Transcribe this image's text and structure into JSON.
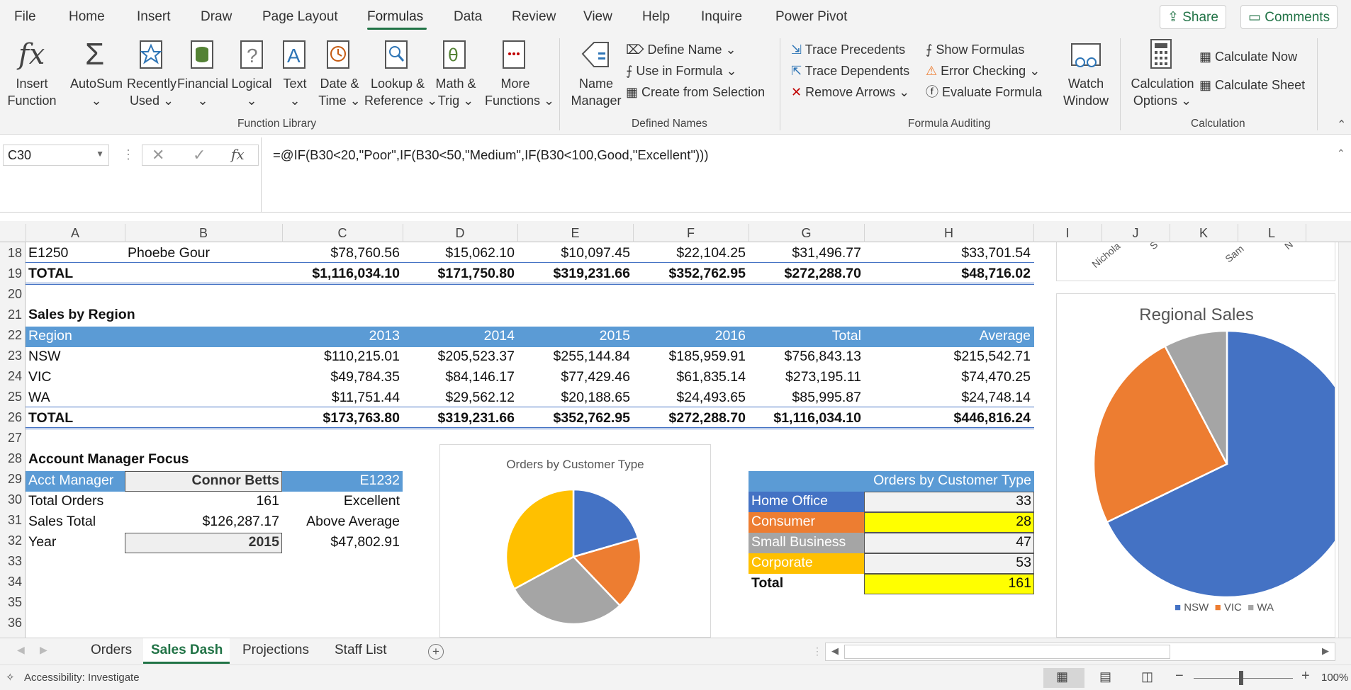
{
  "menu": {
    "items": [
      "File",
      "Home",
      "Insert",
      "Draw",
      "Page Layout",
      "Formulas",
      "Data",
      "Review",
      "View",
      "Help",
      "Inquire",
      "Power Pivot"
    ],
    "active": "Formulas",
    "share": "Share",
    "comments": "Comments"
  },
  "ribbon": {
    "insert_function": [
      "Insert",
      "Function"
    ],
    "autosum": "AutoSum",
    "recently_used": [
      "Recently",
      "Used"
    ],
    "financial": "Financial",
    "logical": "Logical",
    "text": "Text",
    "date_time": [
      "Date &",
      "Time"
    ],
    "lookup": [
      "Lookup &",
      "Reference"
    ],
    "math": [
      "Math &",
      "Trig"
    ],
    "more": [
      "More",
      "Functions"
    ],
    "group_function_library": "Function Library",
    "name_manager": [
      "Name",
      "Manager"
    ],
    "define_name": "Define Name",
    "use_in_formula": "Use in Formula",
    "create_from_selection": "Create from Selection",
    "group_defined_names": "Defined Names",
    "trace_precedents": "Trace Precedents",
    "trace_dependents": "Trace Dependents",
    "remove_arrows": "Remove Arrows",
    "show_formulas": "Show Formulas",
    "error_checking": "Error Checking",
    "evaluate_formula": "Evaluate Formula",
    "group_formula_auditing": "Formula Auditing",
    "watch_window": [
      "Watch",
      "Window"
    ],
    "calc_options": [
      "Calculation",
      "Options"
    ],
    "calc_now": "Calculate Now",
    "calc_sheet": "Calculate Sheet",
    "group_calculation": "Calculation"
  },
  "formula_bar": {
    "name_box": "C30",
    "fx": "fx",
    "formula": "=@IF(B30<20,\"Poor\",IF(B30<50,\"Medium\",IF(B30<100,Good,\"Excellent\")))"
  },
  "columns": [
    "A",
    "B",
    "C",
    "D",
    "E",
    "F",
    "G",
    "H",
    "I",
    "J",
    "K",
    "L"
  ],
  "rows": [
    "18",
    "19",
    "20",
    "21",
    "22",
    "23",
    "24",
    "25",
    "26",
    "27",
    "28",
    "29",
    "30",
    "31",
    "32",
    "33",
    "34",
    "35",
    "36"
  ],
  "sheet": {
    "r18": [
      "E1250",
      "Phoebe Gour",
      "$78,760.56",
      "$15,062.10",
      "$10,097.45",
      "$22,104.25",
      "$31,496.77",
      "$33,701.54"
    ],
    "r19": [
      "TOTAL",
      "$1,116,034.10",
      "$171,750.80",
      "$319,231.66",
      "$352,762.95",
      "$272,288.70",
      "$48,716.02"
    ],
    "sales_title": "Sales by Region",
    "sales_header": [
      "Region",
      "2013",
      "2014",
      "2015",
      "2016",
      "Total",
      "Average"
    ],
    "sales_rows": [
      [
        "NSW",
        "$110,215.01",
        "$205,523.37",
        "$255,144.84",
        "$185,959.91",
        "$756,843.13",
        "$215,542.71"
      ],
      [
        "VIC",
        "$49,784.35",
        "$84,146.17",
        "$77,429.46",
        "$61,835.14",
        "$273,195.11",
        "$74,470.25"
      ],
      [
        "WA",
        "$11,751.44",
        "$29,562.12",
        "$20,188.65",
        "$24,493.65",
        "$85,995.87",
        "$24,748.14"
      ]
    ],
    "sales_total": [
      "TOTAL",
      "$173,763.80",
      "$319,231.66",
      "$352,762.95",
      "$272,288.70",
      "$1,116,034.10",
      "$446,816.24"
    ],
    "acct_title": "Account Manager Focus",
    "acct_header": [
      "Acct Manager",
      "Connor Betts",
      "E1232"
    ],
    "acct_rows": [
      [
        "Total Orders",
        "161",
        "Excellent"
      ],
      [
        "Sales Total",
        "$126,287.17",
        "Above Average"
      ],
      [
        "Year",
        "2015",
        "$47,802.91"
      ]
    ],
    "orders_table": {
      "header": "Orders by Customer Type",
      "rows": [
        {
          "label": "Home Office",
          "value": "33",
          "color": "#4472c4",
          "hl": false
        },
        {
          "label": "Consumer",
          "value": "28",
          "color": "#ed7d31",
          "hl": true
        },
        {
          "label": "Small Business",
          "value": "47",
          "color": "#a5a5a5",
          "hl": false
        },
        {
          "label": "Corporate",
          "value": "53",
          "color": "#ffc000",
          "hl": false
        }
      ],
      "total_label": "Total",
      "total_value": "161"
    },
    "top_chart_labels": [
      "Nichola",
      "S",
      "Sam",
      "N"
    ]
  },
  "charts": {
    "orders_pie": {
      "type": "pie",
      "title": "Orders by Customer Type",
      "categories": [
        "Home Office",
        "Consumer",
        "Small Business",
        "Corporate"
      ],
      "values": [
        33,
        28,
        47,
        53
      ],
      "colors": [
        "#4472c4",
        "#ed7d31",
        "#a5a5a5",
        "#ffc000"
      ]
    },
    "regional_pie": {
      "type": "pie",
      "title": "Regional Sales",
      "categories": [
        "NSW",
        "VIC",
        "WA"
      ],
      "values": [
        756843.13,
        273195.11,
        85995.87
      ],
      "colors": [
        "#4472c4",
        "#ed7d31",
        "#a5a5a5"
      ]
    }
  },
  "chart_data": [
    {
      "type": "pie",
      "title": "Orders by Customer Type",
      "categories": [
        "Home Office",
        "Consumer",
        "Small Business",
        "Corporate"
      ],
      "values": [
        33,
        28,
        47,
        53
      ]
    },
    {
      "type": "pie",
      "title": "Regional Sales",
      "categories": [
        "NSW",
        "VIC",
        "WA"
      ],
      "values": [
        756843.13,
        273195.11,
        85995.87
      ],
      "legend": "bottom"
    }
  ],
  "tabs": {
    "items": [
      "Orders",
      "Sales Dash",
      "Projections",
      "Staff List"
    ],
    "active": "Sales Dash"
  },
  "status": {
    "accessibility": "Accessibility: Investigate",
    "zoom": "100%"
  }
}
